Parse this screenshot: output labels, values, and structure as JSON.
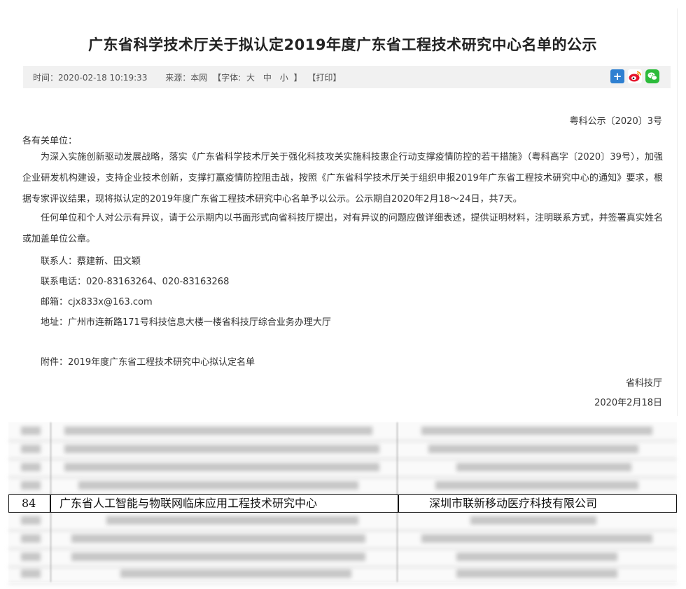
{
  "article": {
    "title": "广东省科学技术厅关于拟认定2019年度广东省工程技术研究中心名单的公示",
    "meta": {
      "time": "时间：2020-02-18 10:19:33",
      "source": "来源：本网",
      "font_prefix": "【字体:",
      "font_large": "大",
      "font_medium": "中",
      "font_small": "小",
      "font_suffix": "】",
      "print": "【打印】"
    },
    "share_icons": [
      "plus-share-icon",
      "weibo-icon",
      "wechat-icon"
    ],
    "doc_number": "粤科公示〔2020〕3号",
    "salutation": "各有关单位：",
    "paragraph1": "为深入实施创新驱动发展战略，落实《广东省科学技术厅关于强化科技攻关实施科技惠企行动支撑疫情防控的若干措施》（粤科高字〔2020〕39号），加强企业研发机构建设，支持企业技术创新，支撑打赢疫情防控阻击战，按照《广东省科学技术厅关于组织申报2019年广东省工程技术研究中心的通知》要求，根据专家评议结果，现将拟认定的2019年度广东省工程技术研究中心名单予以公示。公示期自2020年2月18～24日，共7天。",
    "paragraph2": "任何单位和个人对公示有异议，请于公示期内以书面形式向省科技厅提出，对有异议的问题应做详细表述，提供证明材料，注明联系方式，并签署真实姓名或加盖单位公章。",
    "contact": "联系人：蔡建新、田文颖",
    "phone": "联系电话：020-83163264、020-83163268",
    "email": "邮箱：cjx833x@163.com",
    "address": "地址：广州市连新路171号科技信息大楼一楼省科技厅综合业务办理大厅",
    "attachment": "附件：2019年度广东省工程技术研究中心拟认定名单",
    "signer": "省科技厅",
    "date": "2020年2月18日"
  },
  "table_row": {
    "number": "84",
    "center_name": "广东省人工智能与物联网临床应用工程技术研究中心",
    "company": "深圳市联新移动医疗科技有限公司"
  },
  "colors": {
    "meta_bar": "#f1f1f1",
    "title": "#222222",
    "share_blue": "#2f80d1",
    "share_green": "#2dbb3b",
    "weibo_red": "#e6162d"
  }
}
